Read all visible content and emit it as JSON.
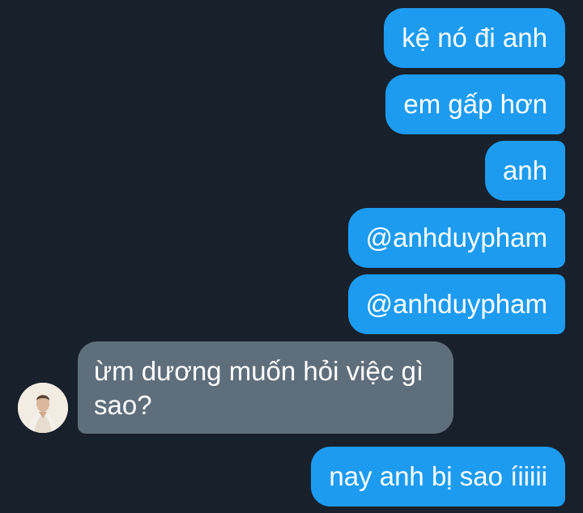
{
  "conversation": {
    "messages": [
      {
        "sender": "me",
        "text": "kệ nó đi anh"
      },
      {
        "sender": "me",
        "text": "em gấp hơn"
      },
      {
        "sender": "me",
        "text": "anh"
      },
      {
        "sender": "me",
        "text": "@anhduypham"
      },
      {
        "sender": "me",
        "text": "@anhduypham"
      },
      {
        "sender": "other",
        "text": "ừm dương muốn hỏi việc gì sao?"
      },
      {
        "sender": "me",
        "text": "nay anh bị sao íiiiii"
      }
    ]
  },
  "colors": {
    "background": "#17202b",
    "outgoing_bubble": "#1d9bf0",
    "incoming_bubble": "#5f6e7b",
    "text": "#ffffff"
  }
}
